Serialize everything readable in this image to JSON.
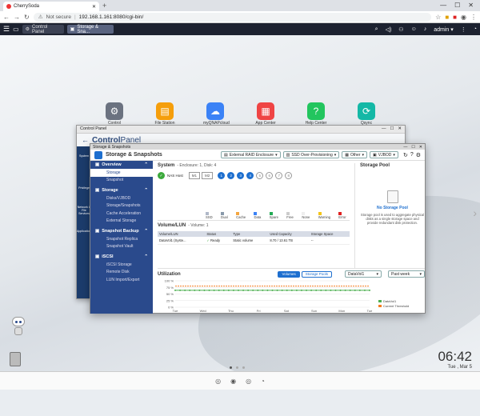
{
  "browser": {
    "tab_title": "CherrySoda",
    "new_tab": "+",
    "controls": {
      "min": "—",
      "max": "☐",
      "close": "✕"
    },
    "not_secure": "Not secure",
    "url": "192.168.1.161:8080/cgi-bin/"
  },
  "qts": {
    "tabs": [
      {
        "label": "Control Panel"
      },
      {
        "label": "Storage & Sna..."
      }
    ],
    "user": "admin"
  },
  "desktop": {
    "icons": [
      {
        "label": "Control Panel",
        "color": "#6b7280",
        "glyph": "⚙"
      },
      {
        "label": "File Station",
        "color": "#f59e0b",
        "glyph": "▤"
      },
      {
        "label": "myQNAPcloud",
        "color": "#3b82f6",
        "glyph": "☁"
      },
      {
        "label": "App Center",
        "color": "#ef4444",
        "glyph": "▦"
      },
      {
        "label": "Help Center",
        "color": "#22c55e",
        "glyph": "?"
      },
      {
        "label": "Qsync Central",
        "color": "#14b8a6",
        "glyph": "⟳"
      }
    ]
  },
  "control_panel": {
    "window_title": "Control Panel",
    "brand_control": "Control",
    "brand_panel": "Panel",
    "side_labels": [
      "System",
      "Privilege",
      "Network & File Services",
      "Applications"
    ]
  },
  "storage": {
    "window_title": "Storage & Snapshots",
    "title": "Storage & Snapshots",
    "dropdowns": {
      "raid": "External RAID Enclosure",
      "ssd": "SSD Over-Provisioning",
      "other": "Other",
      "vjbod": "VJBOD"
    },
    "menu": [
      {
        "section": "Overview",
        "items": [
          "Storage",
          "Snapshot"
        ],
        "selected": 0
      },
      {
        "section": "Storage",
        "items": [
          "Disks/VJBOD",
          "Storage/Snapshots",
          "Cache Acceleration",
          "External Storage"
        ]
      },
      {
        "section": "Snapshot Backup",
        "items": [
          "Snapshot Replica",
          "Snapshot Vault"
        ]
      },
      {
        "section": "iSCSI",
        "items": [
          "iSCSI Storage",
          "Remote Disk",
          "LUN Import/Export"
        ]
      }
    ],
    "system": {
      "title": "System",
      "subtitle": "- Enclosure: 1, Disk: 4",
      "nas_label": "NAS Host",
      "slots": [
        "M1",
        "M2"
      ],
      "disks": [
        {
          "n": "1",
          "on": true
        },
        {
          "n": "2",
          "on": true
        },
        {
          "n": "3",
          "on": true
        },
        {
          "n": "4",
          "on": true
        },
        {
          "n": "5",
          "on": false
        },
        {
          "n": "6",
          "on": false
        },
        {
          "n": "7",
          "on": false
        },
        {
          "n": "8",
          "on": false
        }
      ],
      "legend": [
        {
          "label": "SSD",
          "color": "#b0b8c8"
        },
        {
          "label": "Dual",
          "color": "#8899aa"
        },
        {
          "label": "Cache",
          "color": "#f4a640"
        },
        {
          "label": "Data",
          "color": "#3b82f6"
        },
        {
          "label": "Spare",
          "color": "#22aa55"
        },
        {
          "label": "Free",
          "color": "#cccccc"
        },
        {
          "label": "None",
          "color": "#eeeeee"
        },
        {
          "label": "Warning",
          "color": "#f5c518"
        },
        {
          "label": "Error",
          "color": "#e02020"
        }
      ]
    },
    "volume": {
      "title": "Volume/LUN",
      "subtitle": "- Volume: 1",
      "headers": [
        "Volume/LUN",
        "Status",
        "Type",
        "Used Capacity",
        "Storage Space"
      ],
      "rows": [
        {
          "name": "DataVol1 (Syste...",
          "status": "Ready",
          "type": "Static volume",
          "used": "8.70 / 13.61 TB",
          "space": "--"
        }
      ]
    },
    "pool": {
      "title": "Storage Pool",
      "none": "No Storage Pool",
      "desc": "Storage pool is used to aggregate physical disks as a single storage space and provide redundant disk protection."
    },
    "utilization": {
      "title": "Utilization",
      "btn_volumes": "Volumes",
      "btn_pools": "Storage Pools",
      "select_volume": "DataVol1",
      "select_range": "Past week",
      "legend_vol": "DataVol1",
      "legend_threshold": "Current Threshold"
    }
  },
  "clock": {
    "time": "06:42",
    "date": "Tue , Mar 5"
  },
  "chart_data": {
    "type": "line",
    "categories": [
      "Tue",
      "Wed",
      "Thu",
      "Fri",
      "Sat",
      "Sun",
      "Mon",
      "Tue"
    ],
    "yticks": [
      "100 %",
      "75 %",
      "50 %",
      "25 %",
      "0 %"
    ],
    "ylim": [
      0,
      100
    ],
    "series": [
      {
        "name": "DataVol1",
        "color": "#4caf50",
        "values": [
          64,
          64,
          64,
          64,
          64,
          64,
          64,
          64
        ]
      },
      {
        "name": "Current Threshold",
        "color": "#f47c20",
        "values": [
          80,
          80,
          80,
          80,
          80,
          80,
          80,
          80
        ]
      }
    ]
  }
}
